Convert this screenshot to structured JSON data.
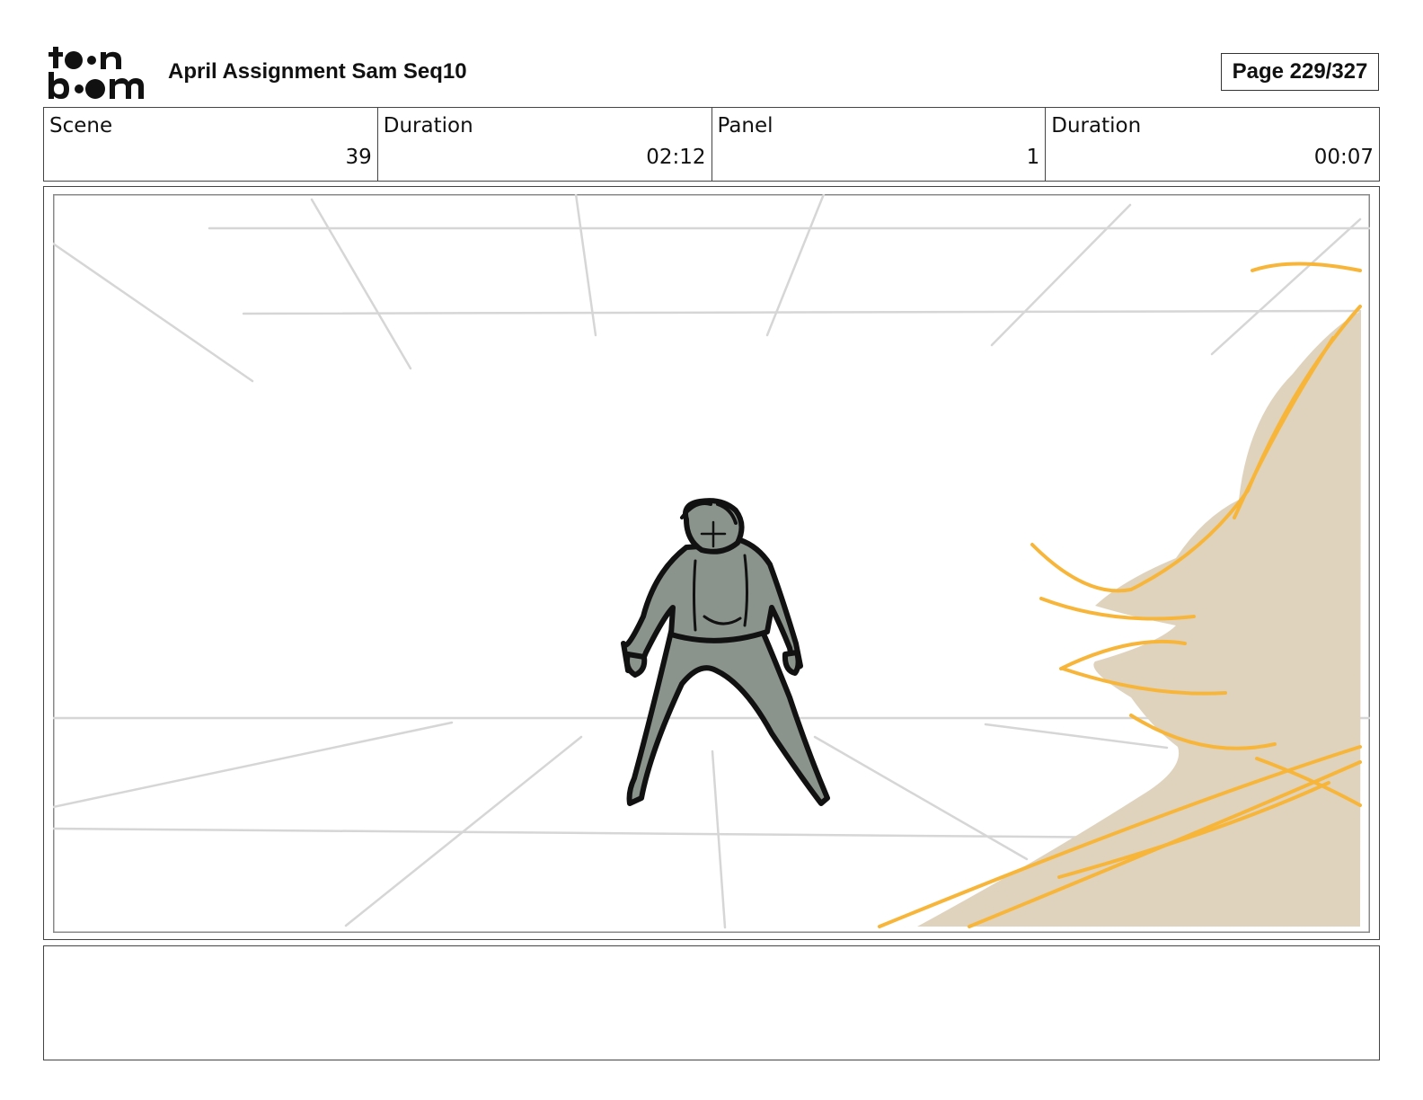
{
  "header": {
    "logo_text": "toon boom",
    "project_title": "April Assignment Sam Seq10",
    "page_label": "Page 229/327"
  },
  "info": {
    "scene_label": "Scene",
    "scene_value": "39",
    "scene_duration_label": "Duration",
    "scene_duration_value": "02:12",
    "panel_label": "Panel",
    "panel_value": "1",
    "panel_duration_label": "Duration",
    "panel_duration_value": "00:07"
  },
  "panel": {
    "colors": {
      "guide_lines": "#d6d6d6",
      "figure_fill": "#8a948c",
      "figure_outline": "#111111",
      "foreground_fill": "#dfd3bd",
      "foreground_strokes": "#f7b63a"
    }
  },
  "notes": {
    "text": ""
  }
}
